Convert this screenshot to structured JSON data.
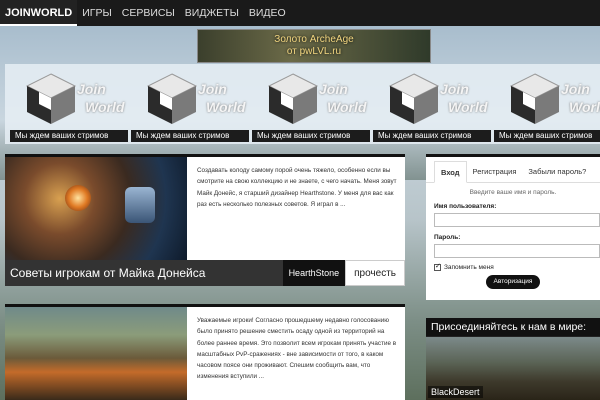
{
  "nav": {
    "logo": "JOINWORLD",
    "items": [
      "ИГРЫ",
      "СЕРВИСЫ",
      "ВИДЖЕТЫ",
      "ВИДЕО"
    ]
  },
  "banner": {
    "line1": "Золото ArcheAge",
    "line2": "от pwLVL.ru"
  },
  "streams": {
    "brand_line1": "Join",
    "brand_line2": "World",
    "label": "Мы ждем ваших стримов",
    "count": 5
  },
  "posts": [
    {
      "excerpt": "Создавать колоду самому порой очень тяжело, особенно если вы смотрите на свою коллекцию и не знаете, с чего начать. Меня зовут Майк Донейс, я старший дизайнер Hearthstone. У меня для вас как раз есть несколько полезных советов. Я играл в ...",
      "title": "Советы игрокам от Майка Донейса",
      "tag": "HearthStone",
      "more": "прочесть"
    },
    {
      "excerpt": "Уважаемые игроки! Согласно прошедшему недавно голосованию было принято решение сместить осаду одной из территорий на более раннее время. Это позволит всем игрокам принять участие в масштабных PvP-сражениях - вне зависимости от того, в каком часовом поясе они проживают. Спешим сообщить вам, что изменения вступили ..."
    }
  ],
  "login": {
    "tabs": [
      "Вход",
      "Регистрация",
      "Забыли пароль?"
    ],
    "hint": "Введите ваше имя и пароль.",
    "username_label": "Имя пользователя:",
    "password_label": "Пароль:",
    "remember_label": "Запомнить меня",
    "submit_label": "Авторизация"
  },
  "joinworld": {
    "title": "Присоединяйтесь к нам в мире:",
    "game": "BlackDesert"
  }
}
